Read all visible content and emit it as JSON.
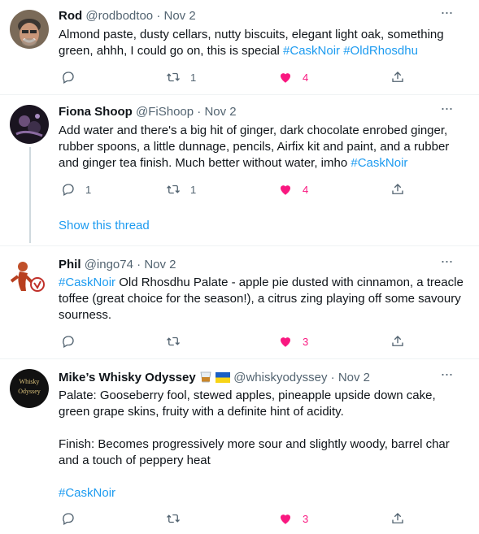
{
  "tweets": [
    {
      "name": "Rod",
      "handle": "@rodbodtoo",
      "date": "Nov 2",
      "text_plain": "Almond paste, dusty cellars, nutty biscuits, elegant light oak, something green, ahhh, I could go on, this is special ",
      "tag1": "#CaskNoir",
      "tag2": "#OldRhosdhu",
      "replies": "",
      "retweets": "1",
      "likes": "4"
    },
    {
      "name": "Fiona Shoop",
      "handle": "@FiShoop",
      "date": "Nov 2",
      "text_plain": "Add water and there's a big hit of ginger, dark chocolate enrobed ginger, rubber spoons, a little dunnage, pencils, Airfix kit and paint, and a rubber and ginger tea finish. Much better without water, imho ",
      "tag1": "#CaskNoir",
      "replies": "1",
      "retweets": "1",
      "likes": "4",
      "show_thread": "Show this thread"
    },
    {
      "name": "Phil",
      "handle": "@ingo74",
      "date": "Nov 2",
      "tag1": "#CaskNoir",
      "text_plain": " Old Rhosdhu Palate - apple pie dusted with cinnamon, a treacle toffee (great choice for the season!), a citrus zing playing off some savoury sourness.",
      "replies": "",
      "retweets": "",
      "likes": "3"
    },
    {
      "name": "Mike’s Whisky Odyssey",
      "handle": "@whiskyodyssey",
      "date": "Nov 2",
      "avatar_text": "Whisky Odyssey",
      "para1": "Palate: Gooseberry fool, stewed apples, pineapple upside down cake, green grape skins, fruity with a definite hint of acidity.",
      "para2": "Finish: Becomes progressively more sour and slightly woody, barrel char and a touch of peppery heat",
      "tag1": "#CaskNoir",
      "replies": "",
      "retweets": "",
      "likes": "3"
    }
  ],
  "separator": "·",
  "more_glyph": "···",
  "colors": {
    "accent": "#1d9bf0",
    "like": "#f91880",
    "muted": "#536471"
  }
}
